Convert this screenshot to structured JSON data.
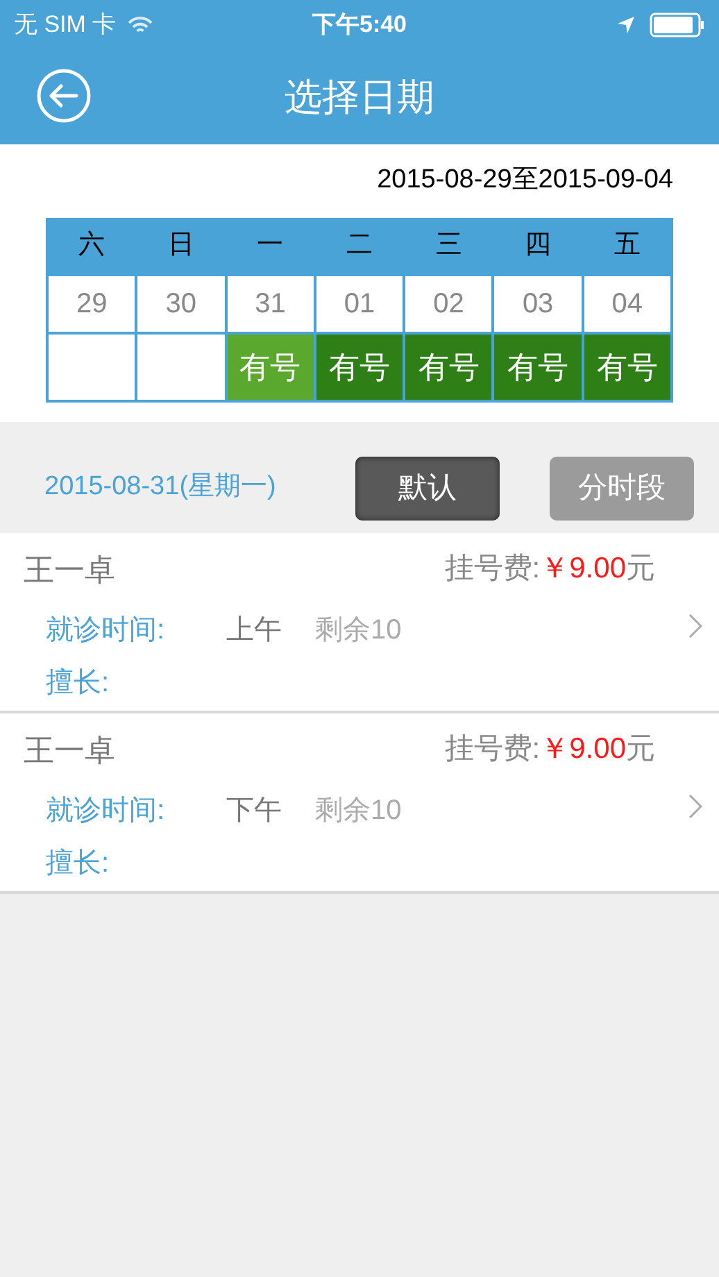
{
  "status_bar": {
    "carrier": "无 SIM 卡",
    "time": "下午5:40"
  },
  "nav_bar": {
    "title": "选择日期"
  },
  "date_range": "2015-08-29至2015-09-04",
  "calendar": {
    "days": [
      {
        "weekday": "六",
        "date": "29",
        "selected": false
      },
      {
        "weekday": "日",
        "date": "30",
        "selected": false
      },
      {
        "weekday": "一",
        "date": "31",
        "slot": "有号",
        "selected": true
      },
      {
        "weekday": "二",
        "date": "01",
        "slot": "有号",
        "selected": false
      },
      {
        "weekday": "三",
        "date": "02",
        "slot": "有号",
        "selected": false
      },
      {
        "weekday": "四",
        "date": "03",
        "slot": "有号",
        "selected": false
      },
      {
        "weekday": "五",
        "date": "04",
        "slot": "有号",
        "selected": false
      }
    ]
  },
  "selected_date": "2015-08-31(星期一)",
  "modes": [
    {
      "label": "默认",
      "selected": true
    },
    {
      "label": "分时段",
      "selected": false
    }
  ],
  "doctors": [
    {
      "name": "王一卓",
      "fee_label": "挂号费:",
      "fee": "￥9.00",
      "fee_unit": "元",
      "time_label": "就诊时间:",
      "period": "上午",
      "remaining": "剩余10",
      "specialty_label": "擅长:"
    },
    {
      "name": "王一卓",
      "fee_label": "挂号费:",
      "fee": "￥9.00",
      "fee_unit": "元",
      "time_label": "就诊时间:",
      "period": "下午",
      "remaining": "剩余10",
      "specialty_label": "擅长:"
    }
  ]
}
